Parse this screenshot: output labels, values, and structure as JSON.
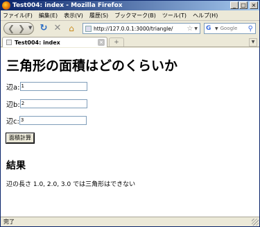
{
  "window": {
    "title": "Test004: index - Mozilla Firefox"
  },
  "menu": [
    "ファイル(F)",
    "編集(E)",
    "表示(V)",
    "履歴(S)",
    "ブックマーク(B)",
    "ツール(T)",
    "ヘルプ(H)"
  ],
  "toolbar": {
    "url": "http://127.0.0.1:3000/triangle/",
    "search_placeholder": "Google"
  },
  "tab": {
    "label": "Test004: index"
  },
  "page": {
    "heading": "三角形の面積はどのくらいか",
    "fields": [
      {
        "label": "辺a:",
        "value": "1"
      },
      {
        "label": "辺b:",
        "value": "2"
      },
      {
        "label": "辺c:",
        "value": "3"
      }
    ],
    "submit_label": "面積計算",
    "result_heading": "結果",
    "result_text": "辺の長さ 1.0, 2.0, 3.0 では三角形はできない"
  },
  "status": {
    "text": "完了"
  },
  "icons": {
    "app": "firefox-icon",
    "back": "back-arrow-icon",
    "forward": "forward-arrow-icon",
    "reload": "reload-icon",
    "stop": "stop-icon",
    "home": "home-icon",
    "bookmark": "star-icon",
    "search_engine": "google-icon",
    "search": "magnifier-icon"
  }
}
